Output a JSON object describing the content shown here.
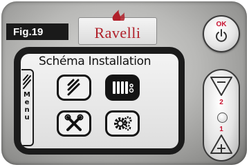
{
  "figure": {
    "label": "Fig.19"
  },
  "brand": {
    "name": "Ravelli",
    "logo": "flame-icon",
    "color": "#b0202a"
  },
  "screen": {
    "title": "Schéma Installation",
    "side_menu": [
      "M",
      "e",
      "n",
      "u"
    ],
    "options": [
      {
        "name": "flame-icon",
        "selected": false
      },
      {
        "name": "radiator-icon",
        "selected": true
      },
      {
        "name": "tools-icon",
        "selected": false
      },
      {
        "name": "gear-icon",
        "selected": false
      }
    ]
  },
  "buttons": {
    "ok": {
      "label": "OK",
      "icon": "power-icon"
    },
    "minus": {
      "number": "2",
      "icon": "minus-icon"
    },
    "plus": {
      "number": "1",
      "icon": "plus-icon"
    }
  },
  "accent_color": "#c8102e"
}
